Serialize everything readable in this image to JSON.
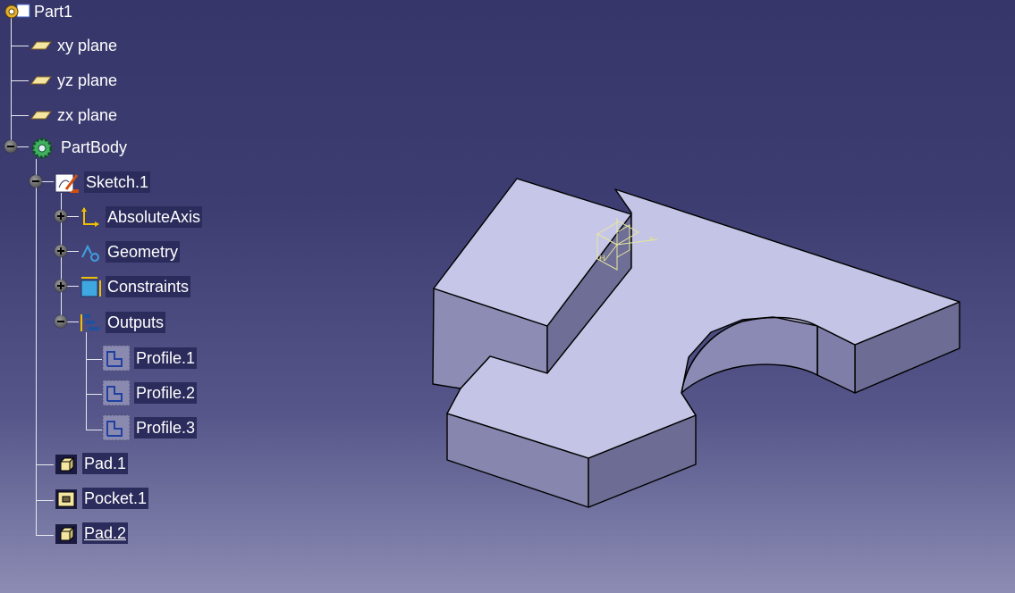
{
  "tree": {
    "root": {
      "label": "Part1",
      "icon": "part-gear-icon"
    },
    "planes": [
      {
        "label": "xy plane",
        "icon": "plane-icon"
      },
      {
        "label": "yz plane",
        "icon": "plane-icon"
      },
      {
        "label": "zx plane",
        "icon": "plane-icon"
      }
    ],
    "partbody": {
      "label": "PartBody",
      "icon": "partbody-gear-icon",
      "expanded": true
    },
    "sketch": {
      "label": "Sketch.1",
      "icon": "sketch-icon",
      "expanded": true
    },
    "sketch_children": [
      {
        "label": "AbsoluteAxis",
        "icon": "axis-icon",
        "expanded": false
      },
      {
        "label": "Geometry",
        "icon": "geometry-icon",
        "expanded": false
      },
      {
        "label": "Constraints",
        "icon": "constraints-icon",
        "expanded": false
      },
      {
        "label": "Outputs",
        "icon": "outputs-icon",
        "expanded": true
      }
    ],
    "profiles": [
      {
        "label": "Profile.1",
        "icon": "profile-icon"
      },
      {
        "label": "Profile.2",
        "icon": "profile-icon"
      },
      {
        "label": "Profile.3",
        "icon": "profile-icon"
      }
    ],
    "features": [
      {
        "label": "Pad.1",
        "icon": "pad-icon"
      },
      {
        "label": "Pocket.1",
        "icon": "pocket-icon"
      },
      {
        "label": "Pad.2",
        "icon": "pad-icon",
        "current": true
      }
    ]
  },
  "viewport": {
    "part_face_top": "#c4c4e8",
    "part_face_side": "#8c8cb2",
    "part_face_front": "#6c6c92",
    "edge_color": "#000000",
    "axis_triad_color": "#e6e67a"
  }
}
